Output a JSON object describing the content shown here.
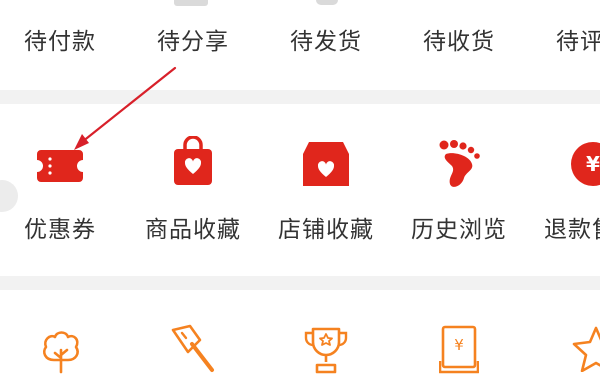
{
  "orders": {
    "items": [
      {
        "label": "待付款",
        "icon": "pending-payment-icon"
      },
      {
        "label": "待分享",
        "icon": "pending-share-icon"
      },
      {
        "label": "待发货",
        "icon": "pending-shipment-icon"
      },
      {
        "label": "待收货",
        "icon": "pending-receipt-icon"
      },
      {
        "label": "待评",
        "icon": "pending-review-icon"
      }
    ]
  },
  "favorites": {
    "items": [
      {
        "label": "优惠券",
        "icon": "coupon-icon"
      },
      {
        "label": "商品收藏",
        "icon": "product-favorites-icon"
      },
      {
        "label": "店铺收藏",
        "icon": "store-favorites-icon"
      },
      {
        "label": "历史浏览",
        "icon": "history-footprint-icon"
      },
      {
        "label": "退款售",
        "icon": "refund-icon"
      }
    ]
  },
  "tools": {
    "items": [
      {
        "icon": "tree-icon"
      },
      {
        "icon": "axe-icon"
      },
      {
        "icon": "trophy-icon"
      },
      {
        "icon": "yuan-card-icon"
      },
      {
        "icon": "star-icon"
      }
    ]
  },
  "colors": {
    "accent_red": "#e0261c",
    "accent_orange": "#f58220",
    "text": "#333333",
    "divider": "#f2f2f2"
  }
}
